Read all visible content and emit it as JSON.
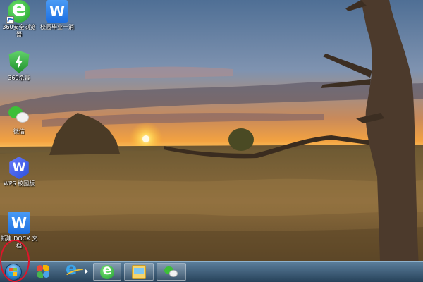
{
  "desktop": {
    "icons": [
      {
        "id": "360se",
        "label": "360安全浏览器",
        "icon": "360-browser-icon"
      },
      {
        "id": "wpsdoc",
        "label": "校园毕业一消",
        "icon": "wps-document-icon"
      },
      {
        "id": "360sd",
        "label": "360杀毒",
        "icon": "360-antivirus-icon"
      },
      {
        "id": "wechat",
        "label": "微信",
        "icon": "wechat-icon"
      },
      {
        "id": "wps",
        "label": "WPS 校园版",
        "icon": "wps-campus-icon"
      },
      {
        "id": "docx",
        "label": "新建 DOCX 文档",
        "icon": "wps-document-icon"
      }
    ]
  },
  "taskbar": {
    "start": {
      "icon": "windows-start-orb-icon",
      "highlighted": true,
      "highlight_color": "#e0142a"
    },
    "pinned": [
      {
        "id": "pinwheel",
        "icon": "pinwheel-app-icon"
      },
      {
        "id": "ie",
        "icon": "internet-explorer-icon"
      },
      {
        "id": "360tb",
        "icon": "360-browser-icon"
      },
      {
        "id": "explorer",
        "icon": "file-explorer-icon"
      },
      {
        "id": "wechat",
        "icon": "wechat-icon"
      }
    ],
    "colors": {
      "bar_top": "#5c7f9c",
      "bar_bottom": "#27425a"
    }
  },
  "wallpaper": {
    "theme": "sunset over heathland with dead tree"
  }
}
